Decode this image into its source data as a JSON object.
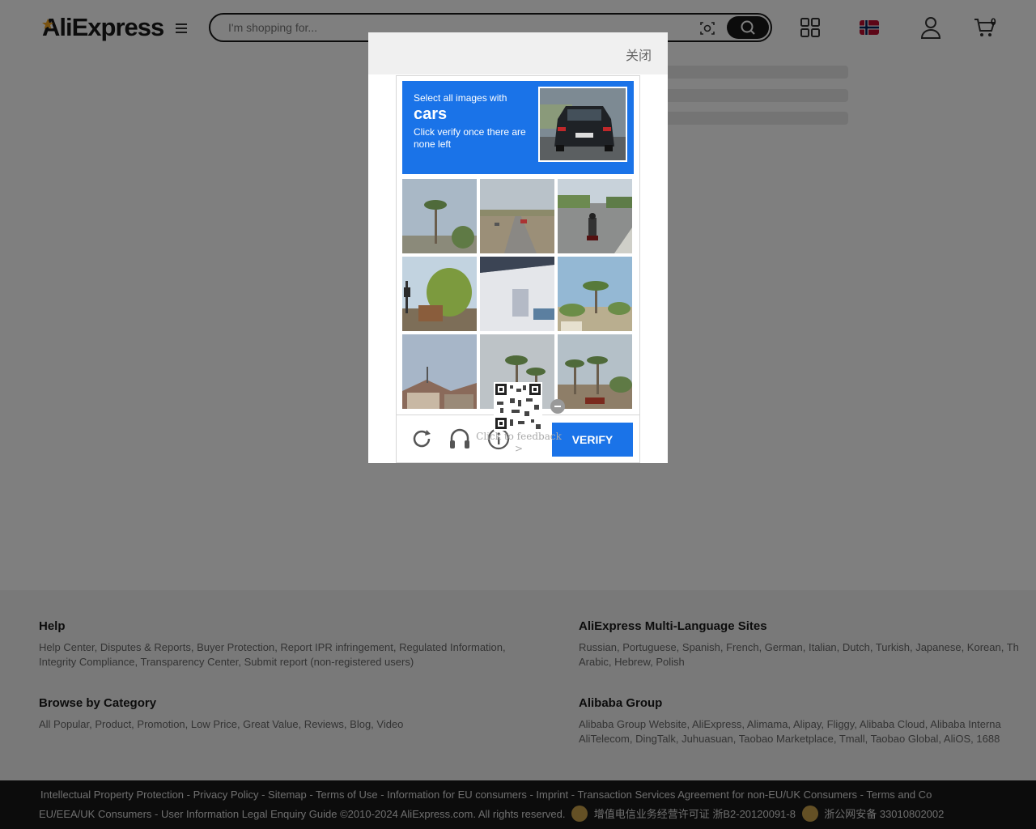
{
  "header": {
    "logo_text": "AliExpress",
    "search_placeholder": "I'm shopping for...",
    "cart_count": "0",
    "icons": [
      "menu-icon",
      "camera-icon",
      "search-icon",
      "qr-code-icon",
      "norway-flag-icon",
      "account-icon",
      "cart-icon"
    ]
  },
  "footer": {
    "help": {
      "title": "Help",
      "links_line1": "Help Center, Disputes & Reports, Buyer Protection, Report IPR infringement, Regulated Information,",
      "links_line2": "Integrity Compliance, Transparency Center, Submit report (non-registered users)"
    },
    "multi_language": {
      "title": "AliExpress Multi-Language Sites",
      "links_line1": "Russian, Portuguese, Spanish, French, German, Italian, Dutch, Turkish, Japanese, Korean, Th",
      "links_line2": "Arabic, Hebrew, Polish"
    },
    "browse": {
      "title": "Browse by Category",
      "links": "All Popular, Product, Promotion, Low Price, Great Value, Reviews, Blog, Video"
    },
    "alibaba": {
      "title": "Alibaba Group",
      "links_line1": "Alibaba Group Website, AliExpress, Alimama, Alipay, Fliggy, Alibaba Cloud, Alibaba Interna",
      "links_line2": "AliTelecom, DingTalk, Juhuasuan, Taobao Marketplace, Tmall, Taobao Global, AliOS, 1688"
    },
    "bottom_line1": "Intellectual Property Protection - Privacy Policy - Sitemap - Terms of Use - Information for EU consumers - Imprint - Transaction Services Agreement for non-EU/UK Consumers - Terms and Co",
    "bottom_line2_a": "EU/EEA/UK Consumers - User Information Legal Enquiry Guide ©2010-2024 AliExpress.com. All rights reserved.",
    "bottom_line2_b": "增值电信业务经营许可证 浙B2-20120091-8",
    "bottom_line2_c": "浙公网安备 33010802002"
  },
  "modal": {
    "close_label": "关闭"
  },
  "captcha": {
    "instruction_line1": "Select all images with",
    "target": "cars",
    "instruction_line3": "Click verify once there are none left",
    "verify_label": "VERIFY",
    "feedback_text": "Click to feedback >",
    "tiles": [
      "palm-tree",
      "highway-road",
      "motorcycle-road",
      "tree-street",
      "white-building",
      "palm-trees-field",
      "rooftop-houses",
      "palm-trees-sky",
      "palm-trees-street"
    ],
    "colors": {
      "accent": "#1a73e8"
    }
  }
}
